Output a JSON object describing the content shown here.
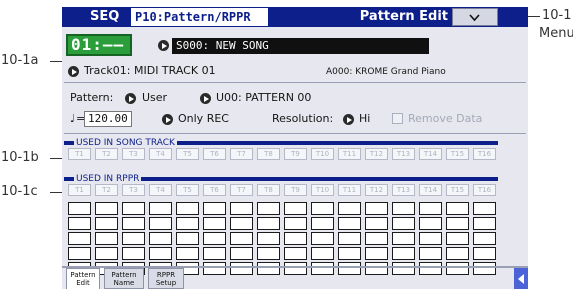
{
  "callouts": {
    "menu_label_line1": "10-1",
    "menu_label_line2": "Menu",
    "a": "10-1a",
    "b": "10-1b",
    "c": "10-1c"
  },
  "header": {
    "mode": "SEQ",
    "page": "P10:Pattern/RPPR",
    "title": "Pattern Edit"
  },
  "location": "01:——",
  "song": "S000: NEW SONG",
  "track": {
    "label": "Track01: MIDI TRACK 01",
    "program": "A000: KROME Grand Piano"
  },
  "pattern": {
    "label": "Pattern:",
    "bank": "User",
    "name": "U00: PATTERN 00"
  },
  "tempo": {
    "symbol": "♩",
    "eq": "=",
    "value": "120.00",
    "mode": "Only REC"
  },
  "resolution": {
    "label": "Resolution:",
    "value": "Hi"
  },
  "remove_data": "Remove Data",
  "sections": {
    "song_track": "USED IN SONG TRACK",
    "rppr": "USED IN RPPR"
  },
  "tracks": [
    "T1",
    "T2",
    "T3",
    "T4",
    "T5",
    "T6",
    "T7",
    "T8",
    "T9",
    "T10",
    "T11",
    "T12",
    "T13",
    "T14",
    "T15",
    "T16"
  ],
  "tabs": [
    {
      "line1": "Pattern",
      "line2": "Edit"
    },
    {
      "line1": "Pattern",
      "line2": "Name"
    },
    {
      "line1": "RPPR",
      "line2": "Setup"
    }
  ],
  "colors": {
    "accent": "#0c1f8b",
    "location": "#2b9e3b",
    "nav": "#4c63d8"
  }
}
